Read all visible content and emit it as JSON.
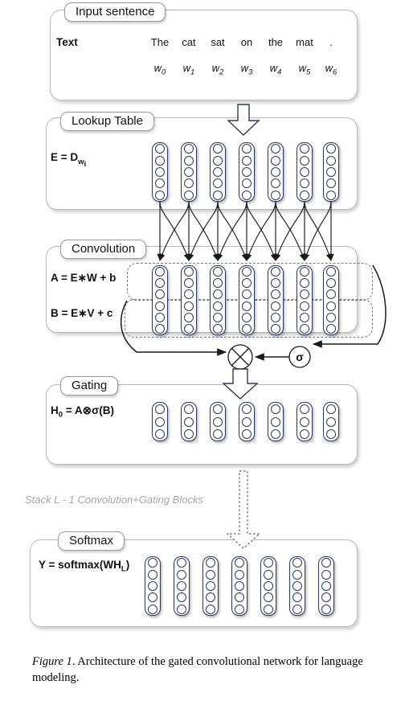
{
  "figure": {
    "caption_prefix": "Figure 1",
    "caption_text": ". Architecture of the gated convolutional network for language modeling."
  },
  "colors": {
    "node_stroke": "#2b3a5c",
    "panel_border": "#b9b9b9",
    "dashed_border": "#7a7a7a",
    "arrow": "#1a1a1a",
    "stack_text": "#a6a6a6",
    "block_arrow_stroke": "#2b3a5c"
  },
  "panels": [
    {
      "id": "input",
      "label": "Input sentence"
    },
    {
      "id": "lookup",
      "label": "Lookup Table"
    },
    {
      "id": "convolution",
      "label": "Convolution"
    },
    {
      "id": "gating",
      "label": "Gating"
    },
    {
      "id": "softmax",
      "label": "Softmax"
    }
  ],
  "input_sentence": {
    "row_label": "Text",
    "words": [
      "The",
      "cat",
      "sat",
      "on",
      "the",
      "mat",
      "."
    ],
    "indices": [
      "w",
      "w",
      "w",
      "w",
      "w",
      "w",
      "w"
    ],
    "index_subs": [
      "0",
      "1",
      "2",
      "3",
      "4",
      "5",
      "6"
    ]
  },
  "lookup": {
    "formula_main": "E = D",
    "formula_sub": "w",
    "formula_subsub": "i",
    "columns": 7,
    "nodes_per_column": 5
  },
  "convolution": {
    "formula_a": "A = E∗W + b",
    "formula_b": "B = E∗V + c",
    "columns": 7,
    "nodes_per_column": 6,
    "group_a_label": "A",
    "group_b_label": "B"
  },
  "gate": {
    "product_symbol": "⊗",
    "sigmoid_symbol": "σ"
  },
  "gating": {
    "formula_main": "H",
    "formula_sub": "0",
    "formula_rest": " = A⊗σ(B)",
    "columns": 7,
    "nodes_per_column": 3
  },
  "stack_note": "Stack L - 1 Convolution+Gating Blocks",
  "softmax": {
    "formula_pre": "Y = softmax(WH",
    "formula_sub": "L",
    "formula_post": ")",
    "columns": 7,
    "nodes_per_column": 5
  }
}
